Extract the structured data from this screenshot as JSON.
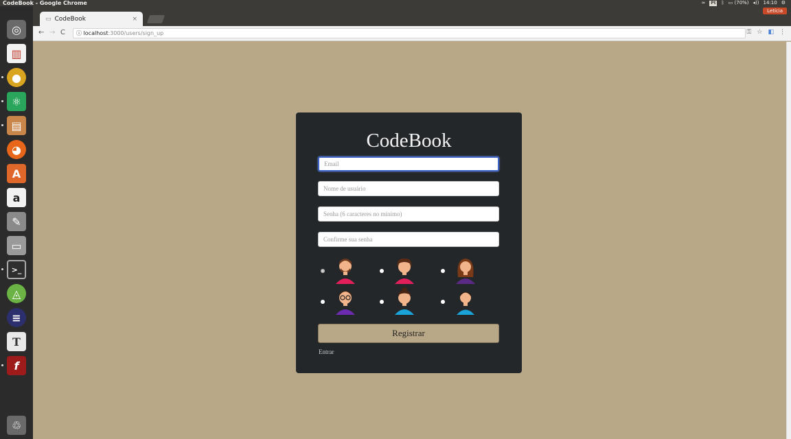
{
  "window": {
    "title": "CodeBook - Google Chrome"
  },
  "system_tray": {
    "lang": "Pt",
    "battery": "(70%)",
    "time": "14:10",
    "user": "Letícia"
  },
  "browser": {
    "tab_title": "CodeBook",
    "tab_close": "×",
    "url_host": "localhost",
    "url_path": ":3000/users/sign_up"
  },
  "form": {
    "brand": "CodeBook",
    "email_placeholder": "Email",
    "username_placeholder": "Nome de usuário",
    "password_placeholder": "Senha (6 caracteres no mínimo)",
    "confirm_placeholder": "Confirme sua senha",
    "register_label": "Registrar",
    "login_link": "Entrar",
    "avatars": [
      {
        "icon": "avatar-man-beard-icon",
        "selected": true
      },
      {
        "icon": "avatar-woman-short-hair-icon",
        "selected": false
      },
      {
        "icon": "avatar-woman-long-hair-icon",
        "selected": false
      },
      {
        "icon": "avatar-man-glasses-icon",
        "selected": false
      },
      {
        "icon": "avatar-woman-bun-icon",
        "selected": false
      },
      {
        "icon": "avatar-boy-icon",
        "selected": false
      }
    ]
  },
  "colors": {
    "page_bg": "#b8a888",
    "card_bg": "#24272a",
    "focus": "#3d63c9"
  }
}
